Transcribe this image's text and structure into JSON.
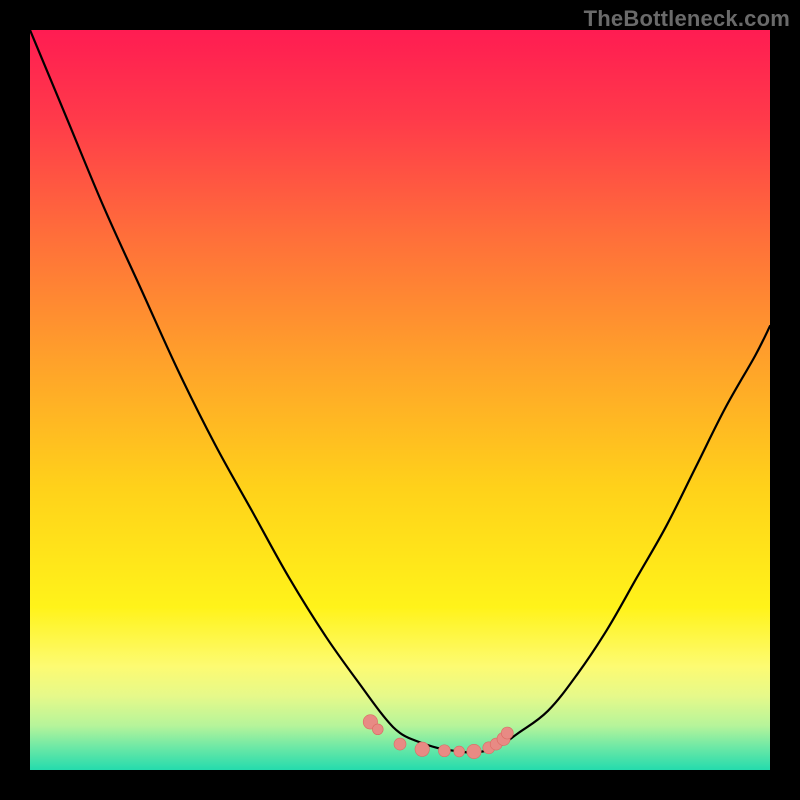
{
  "attribution": "TheBottleneck.com",
  "colors": {
    "bg": "#000000",
    "curve": "#000000",
    "marker_fill": "#e88a84",
    "marker_stroke": "#da6b63",
    "gradient_stops": [
      {
        "offset": 0.0,
        "color": "#ff1c52"
      },
      {
        "offset": 0.12,
        "color": "#ff3a4a"
      },
      {
        "offset": 0.28,
        "color": "#ff6f3a"
      },
      {
        "offset": 0.45,
        "color": "#ffa22a"
      },
      {
        "offset": 0.62,
        "color": "#ffd21a"
      },
      {
        "offset": 0.78,
        "color": "#fff31a"
      },
      {
        "offset": 0.86,
        "color": "#fdfb72"
      },
      {
        "offset": 0.9,
        "color": "#e6f98a"
      },
      {
        "offset": 0.94,
        "color": "#b6f49a"
      },
      {
        "offset": 0.97,
        "color": "#6be8a6"
      },
      {
        "offset": 1.0,
        "color": "#24dbad"
      }
    ]
  },
  "chart_data": {
    "type": "line",
    "title": "",
    "xlabel": "",
    "ylabel": "",
    "xlim": [
      0,
      100
    ],
    "ylim": [
      0,
      100
    ],
    "grid": false,
    "legend": false,
    "series": [
      {
        "name": "left-arm",
        "x": [
          0,
          5,
          10,
          15,
          20,
          25,
          30,
          35,
          40,
          45,
          48,
          50,
          52,
          55,
          58,
          60
        ],
        "y": [
          100,
          88,
          76,
          65,
          54,
          44,
          35,
          26,
          18,
          11,
          7,
          5,
          4,
          3,
          2.5,
          2.3
        ]
      },
      {
        "name": "right-arm",
        "x": [
          60,
          63,
          66,
          70,
          74,
          78,
          82,
          86,
          90,
          94,
          98,
          100
        ],
        "y": [
          2.3,
          3,
          5,
          8,
          13,
          19,
          26,
          33,
          41,
          49,
          56,
          60
        ]
      },
      {
        "name": "valley-markers",
        "x": [
          46,
          47,
          50,
          53,
          56,
          58,
          60,
          62,
          63,
          64,
          64.5
        ],
        "y": [
          6.5,
          5.5,
          3.5,
          2.8,
          2.6,
          2.5,
          2.5,
          3.0,
          3.5,
          4.2,
          5.0
        ]
      }
    ]
  }
}
